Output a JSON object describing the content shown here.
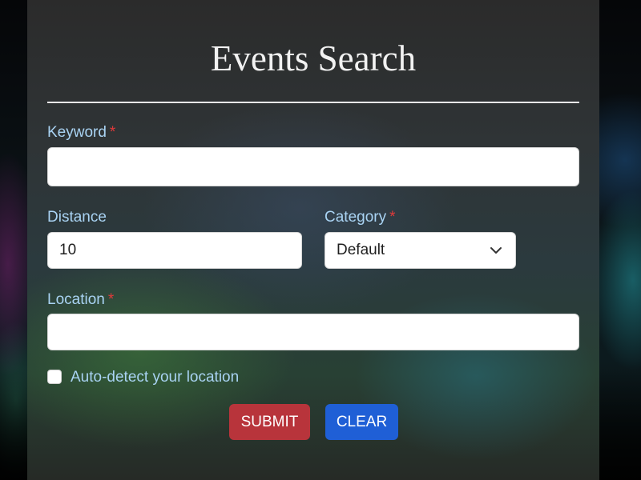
{
  "form": {
    "title": "Events Search",
    "keyword": {
      "label": "Keyword",
      "required_mark": "*",
      "value": ""
    },
    "distance": {
      "label": "Distance",
      "value": "10"
    },
    "category": {
      "label": "Category",
      "required_mark": "*",
      "selected": "Default"
    },
    "location": {
      "label": "Location",
      "required_mark": "*",
      "value": ""
    },
    "auto_detect": {
      "label": "Auto-detect your location",
      "checked": false
    },
    "submit_label": "SUBMIT",
    "clear_label": "CLEAR"
  },
  "colors": {
    "label_text": "#a9d3f3",
    "required_mark": "#e03a3a",
    "submit_button": "#b8343b",
    "clear_button": "#1f5fd6"
  },
  "icons": {
    "select_chevron": "chevron-down-icon"
  }
}
